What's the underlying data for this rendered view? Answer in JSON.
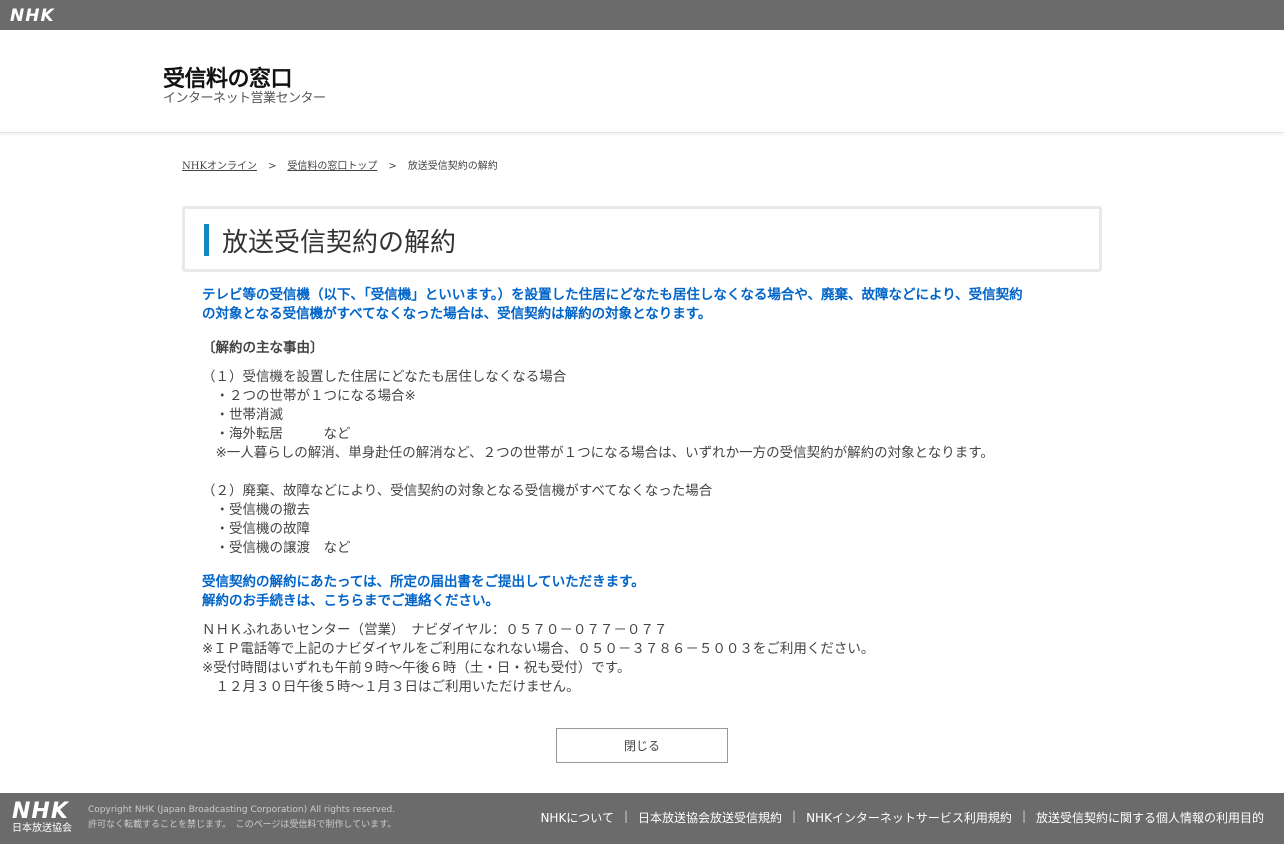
{
  "topbar": {
    "logo": "NHK"
  },
  "header": {
    "title": "受信料の窓口",
    "subtitle": "インターネット営業センター"
  },
  "breadcrumb": {
    "items": [
      "NHKオンライン",
      "受信料の窓口トップ",
      "放送受信契約の解約"
    ],
    "sep": ">"
  },
  "page_title": "放送受信契約の解約",
  "content": {
    "lead": [
      "テレビ等の受信機（以下、「受信機」といいます。）を設置した住居にどなたも居住しなくなる場合や、廃棄、故障などにより、受信契約",
      "の対象となる受信機がすべてなくなった場合は、受信契約は解約の対象となります。"
    ],
    "subhead": "〔解約の主な事由〕",
    "reasons": [
      "（１）受信機を設置した住居にどなたも居住しなくなる場合",
      "　・２つの世帯が１つになる場合※",
      "　・世帯消滅",
      "　・海外転居　　　など",
      "　※一人暮らしの解消、単身赴任の解消など、２つの世帯が１つになる場合は、いずれか一方の受信契約が解約の対象となります。",
      " ",
      "（２）廃棄、故障などにより、受信契約の対象となる受信機がすべてなくなった場合",
      "　・受信機の撤去",
      "　・受信機の故障",
      "　・受信機の譲渡　など"
    ],
    "notice": [
      "受信契約の解約にあたっては、所定の届出書をご提出していただきます。",
      "解約のお手続きは、こちらまでご連絡ください。"
    ],
    "contact": [
      "ＮＨＫふれあいセンター（営業）　ナビダイヤル：０５７０－０７７－０７７",
      "※ＩＰ電話等で上記のナビダイヤルをご利用になれない場合、０５０－３７８６－５００３をご利用ください。",
      "※受付時間はいずれも午前９時～午後６時（土・日・祝も受付）です。",
      "　１２月３０日午後５時～１月３日はご利用いただけません。"
    ]
  },
  "close_button": "閉じる",
  "footer": {
    "logo": "NHK",
    "logo_sub": "日本放送協会",
    "copyright": "Copyright NHK (Japan Broadcasting Corporation) All rights reserved.",
    "copyright2": "許可なく転載することを禁じます。　このページは受信料で制作しています。",
    "links": [
      "NHKについて",
      "日本放送協会放送受信規約",
      "NHKインターネットサービス利用規約",
      "放送受信契約に関する個人情報の利用目的"
    ]
  },
  "colors": {
    "accent": "#0f88c4",
    "lead_text": "#0064c8",
    "bars": "#6b6b6b"
  }
}
